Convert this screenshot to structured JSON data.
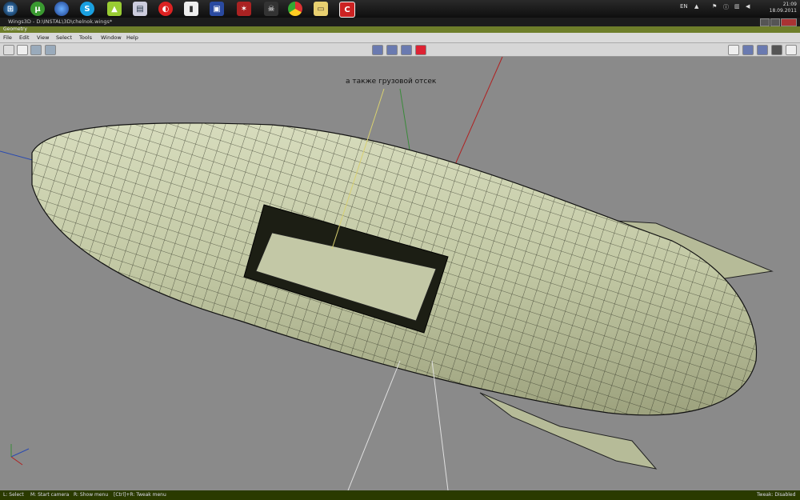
{
  "taskbar": {
    "apps": [
      "start-orb-icon",
      "utorrent-icon",
      "google-earth-icon",
      "skype-icon",
      "android-icon",
      "scanner-icon",
      "virus-scan-icon",
      "phone-icon",
      "floppy-save-icon",
      "fire-icon",
      "skull-icon",
      "chrome-icon",
      "file-manager-icon",
      "wings3d-icon"
    ],
    "lang": "EN",
    "time": "21:09",
    "date": "18.09.2011"
  },
  "window": {
    "title": "Wings3D - D:\\INSTAL\\3D\\chelnok.wings*"
  },
  "geometry_label": "Geometry",
  "menu": [
    "File",
    "Edit",
    "View",
    "Select",
    "Tools",
    "Window",
    "Help"
  ],
  "viewport": {
    "annotation": "а также грузовой отсек"
  },
  "status": {
    "select": "L: Select",
    "camera": "M: Start camera",
    "menu": "R: Show menu",
    "tweak_menu": "[Ctrl]+R: Tweak menu",
    "tweak_state": "Tweak: Disabled"
  }
}
